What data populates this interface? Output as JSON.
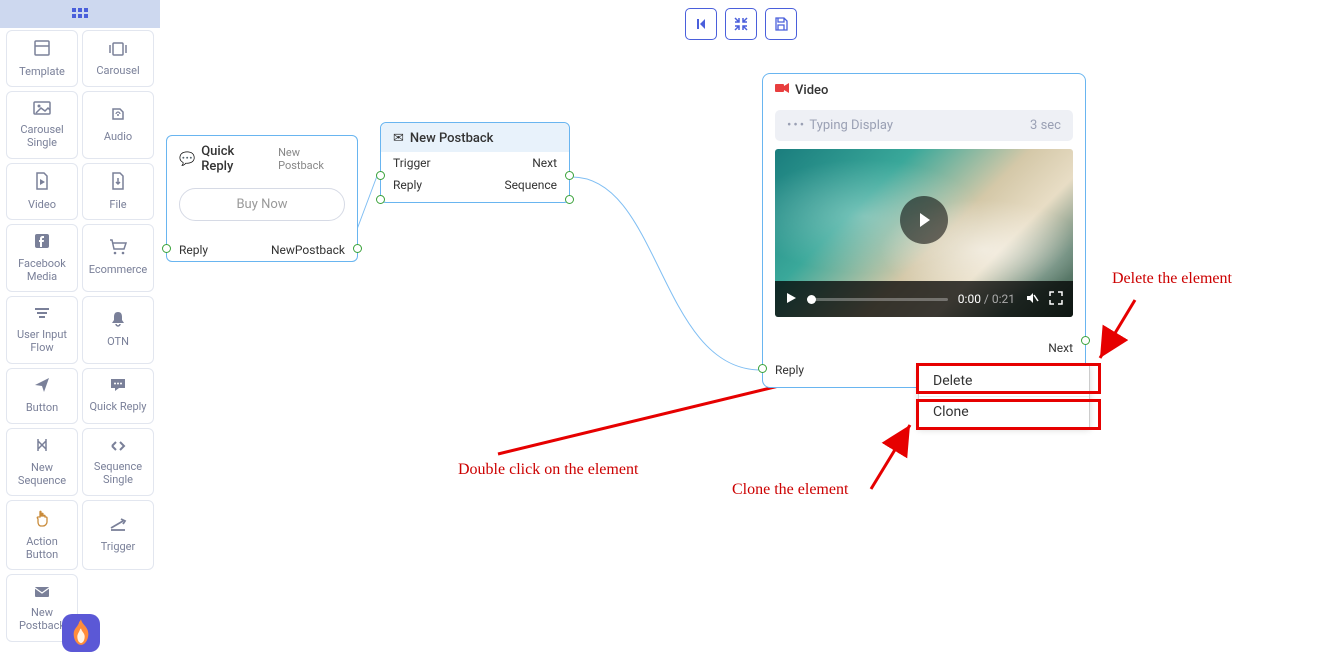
{
  "sidebar": {
    "items": [
      {
        "icon": "template",
        "label": "Template"
      },
      {
        "icon": "carousel",
        "label": "Carousel"
      },
      {
        "icon": "image",
        "label": "Carousel Single"
      },
      {
        "icon": "audio",
        "label": "Audio"
      },
      {
        "icon": "video",
        "label": "Video"
      },
      {
        "icon": "file",
        "label": "File"
      },
      {
        "icon": "facebook",
        "label": "Facebook Media"
      },
      {
        "icon": "cart",
        "label": "Ecommerce"
      },
      {
        "icon": "flow",
        "label": "User Input Flow"
      },
      {
        "icon": "bell",
        "label": "OTN"
      },
      {
        "icon": "plane",
        "label": "Button"
      },
      {
        "icon": "chat",
        "label": "Quick Reply"
      },
      {
        "icon": "newseq",
        "label": "New Sequence"
      },
      {
        "icon": "seqsingle",
        "label": "Sequence Single"
      },
      {
        "icon": "pointer",
        "label": "Action Button"
      },
      {
        "icon": "trigger",
        "label": "Trigger"
      },
      {
        "icon": "mail",
        "label": "New Postback"
      }
    ]
  },
  "topbar": {
    "back_title": "Back",
    "center_title": "Collapse",
    "save_title": "Save"
  },
  "nodes": {
    "quick_reply": {
      "title": "Quick Reply",
      "subtitle": "New Postback",
      "button_label": "Buy Now",
      "left_port": "Reply",
      "right_port": "NewPostback"
    },
    "postback": {
      "title": "New Postback",
      "rows": [
        {
          "left": "Trigger",
          "right": "Next"
        },
        {
          "left": "Reply",
          "right": "Sequence"
        }
      ]
    },
    "video": {
      "title": "Video",
      "typing_label": "Typing Display",
      "typing_duration": "3 sec",
      "time_current": "0:00",
      "time_total": "0:21",
      "port_next": "Next",
      "port_reply": "Reply"
    }
  },
  "context_menu": {
    "delete": "Delete",
    "clone": "Clone"
  },
  "annotations": {
    "delete": "Delete the element",
    "clone": "Clone the element",
    "dblclick": "Double click on the element"
  }
}
